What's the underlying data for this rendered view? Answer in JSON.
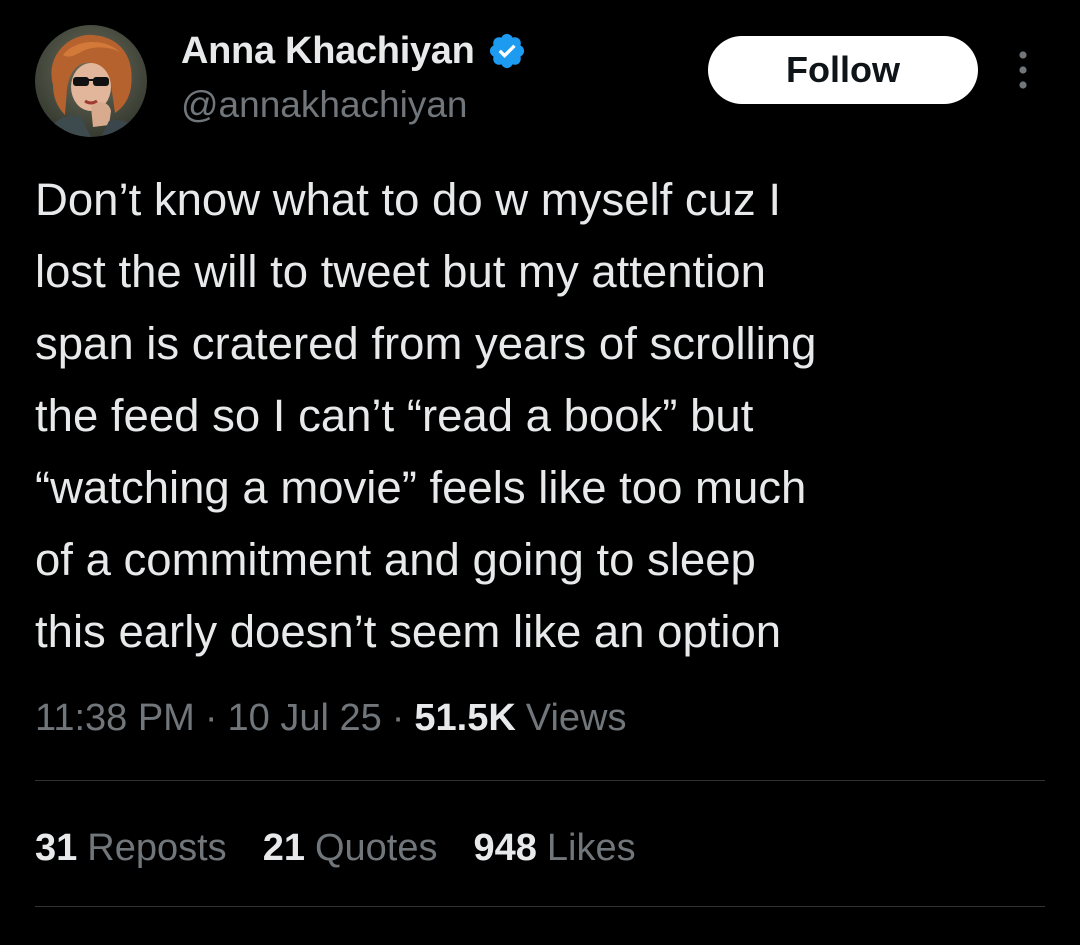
{
  "author": {
    "display_name": "Anna Khachiyan",
    "handle": "@annakhachiyan",
    "verified": true,
    "avatar_icon": "profile-photo"
  },
  "actions": {
    "follow_label": "Follow",
    "more_icon": "vertical-ellipsis-icon"
  },
  "tweet": {
    "lines": [
      "Don’t know what to do w myself cuz I",
      "lost the will to tweet but my attention",
      "span is cratered from years of scrolling",
      "the feed so I can’t “read a book” but",
      "“watching a movie” feels like too much",
      "of a commitment and going to sleep",
      "this early doesn’t seem like an option"
    ]
  },
  "meta": {
    "time": "11:38 PM",
    "separator": "·",
    "date": "10 Jul 25",
    "views_count": "51.5K",
    "views_label": "Views"
  },
  "stats": [
    {
      "count": "31",
      "label": "Reposts"
    },
    {
      "count": "21",
      "label": "Quotes"
    },
    {
      "count": "948",
      "label": "Likes"
    }
  ],
  "colors": {
    "background": "#000000",
    "primary_text": "#e7e9ea",
    "secondary_text": "#71767b",
    "verified_blue": "#1d9bf0",
    "divider": "#2f3336",
    "follow_bg": "#ffffff"
  }
}
